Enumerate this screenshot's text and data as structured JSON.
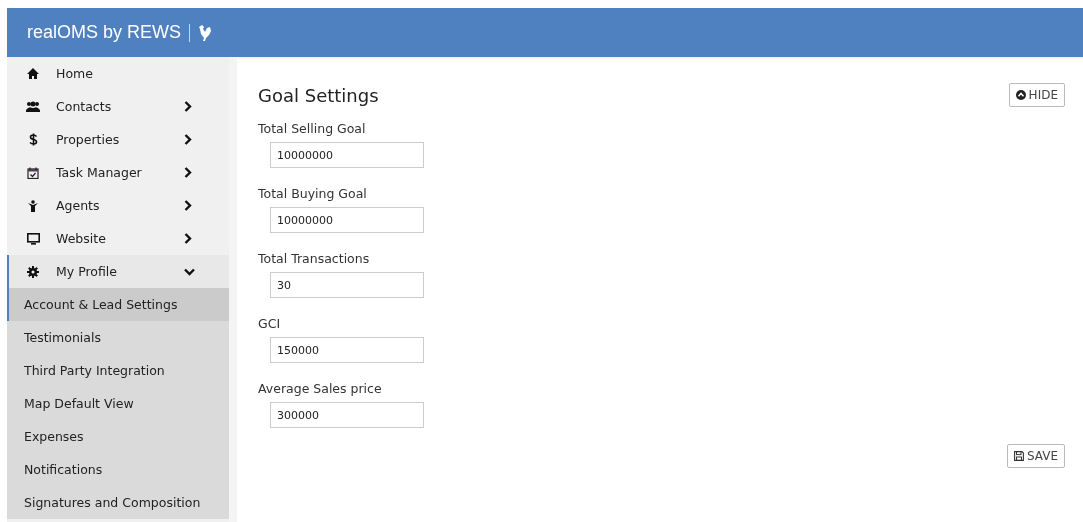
{
  "brand": {
    "title": "realOMS by REWS"
  },
  "nav": [
    {
      "label": "Home",
      "has_children": false,
      "expanded": false
    },
    {
      "label": "Contacts",
      "has_children": true,
      "expanded": false
    },
    {
      "label": "Properties",
      "has_children": true,
      "expanded": false
    },
    {
      "label": "Task Manager",
      "has_children": true,
      "expanded": false
    },
    {
      "label": "Agents",
      "has_children": true,
      "expanded": false
    },
    {
      "label": "Website",
      "has_children": true,
      "expanded": false
    },
    {
      "label": "My Profile",
      "has_children": true,
      "expanded": true,
      "children": [
        {
          "label": "Account & Lead Settings",
          "selected": true
        },
        {
          "label": "Testimonials",
          "selected": false
        },
        {
          "label": "Third Party Integration",
          "selected": false
        },
        {
          "label": "Map Default View",
          "selected": false
        },
        {
          "label": "Expenses",
          "selected": false
        },
        {
          "label": "Notifications",
          "selected": false
        },
        {
          "label": "Signatures and Composition",
          "selected": false
        }
      ]
    }
  ],
  "panel": {
    "title": "Goal Settings",
    "hide_button": "HIDE",
    "save_button": "SAVE",
    "fields": [
      {
        "label": "Total Selling Goal",
        "value": "10000000"
      },
      {
        "label": "Total Buying Goal",
        "value": "10000000"
      },
      {
        "label": "Total Transactions",
        "value": "30"
      },
      {
        "label": "GCI",
        "value": "150000"
      },
      {
        "label": "Average Sales price",
        "value": "300000"
      }
    ]
  }
}
